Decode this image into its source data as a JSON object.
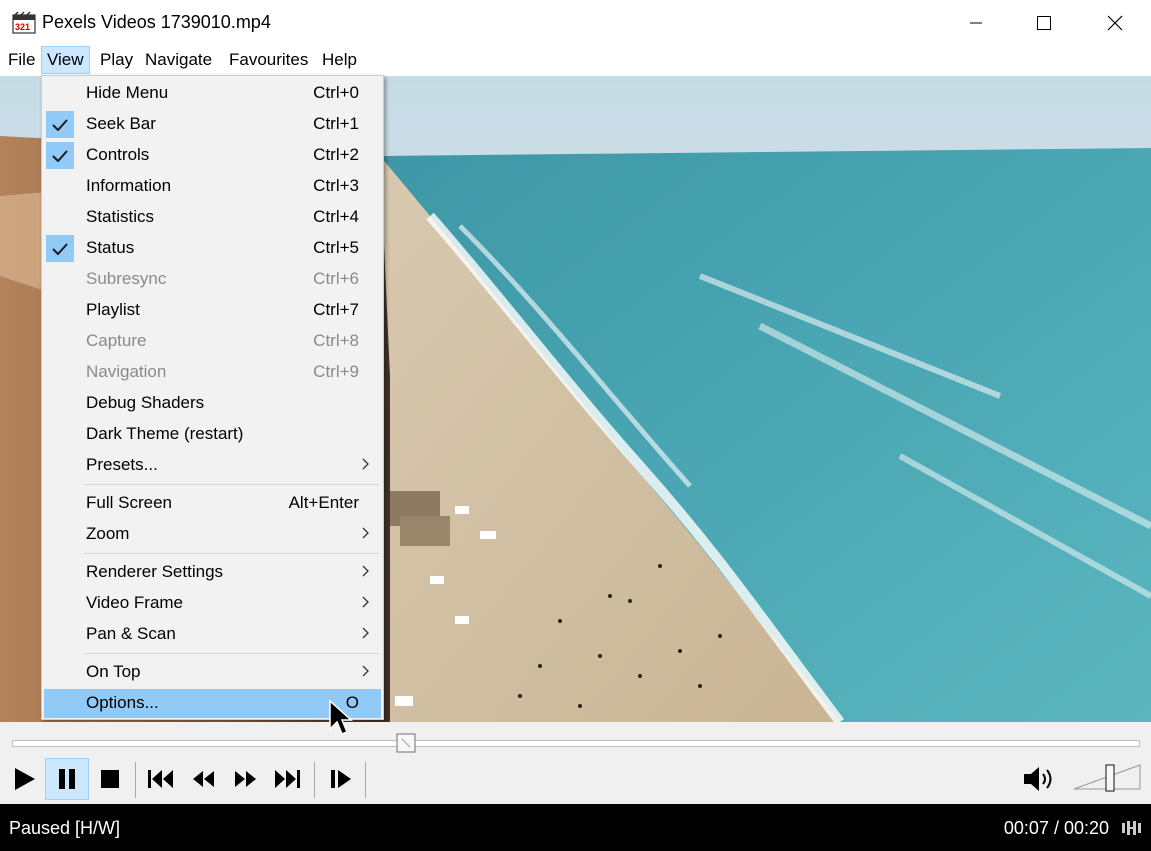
{
  "window": {
    "title": "Pexels Videos 1739010.mp4"
  },
  "menubar": {
    "items": [
      "File",
      "View",
      "Play",
      "Navigate",
      "Favourites",
      "Help"
    ],
    "active": "View"
  },
  "view_menu": {
    "items": [
      {
        "label": "Hide Menu",
        "shortcut": "Ctrl+0",
        "checked": false,
        "disabled": false,
        "submenu": false
      },
      {
        "label": "Seek Bar",
        "shortcut": "Ctrl+1",
        "checked": true,
        "disabled": false,
        "submenu": false
      },
      {
        "label": "Controls",
        "shortcut": "Ctrl+2",
        "checked": true,
        "disabled": false,
        "submenu": false
      },
      {
        "label": "Information",
        "shortcut": "Ctrl+3",
        "checked": false,
        "disabled": false,
        "submenu": false
      },
      {
        "label": "Statistics",
        "shortcut": "Ctrl+4",
        "checked": false,
        "disabled": false,
        "submenu": false
      },
      {
        "label": "Status",
        "shortcut": "Ctrl+5",
        "checked": true,
        "disabled": false,
        "submenu": false
      },
      {
        "label": "Subresync",
        "shortcut": "Ctrl+6",
        "checked": false,
        "disabled": true,
        "submenu": false
      },
      {
        "label": "Playlist",
        "shortcut": "Ctrl+7",
        "checked": false,
        "disabled": false,
        "submenu": false
      },
      {
        "label": "Capture",
        "shortcut": "Ctrl+8",
        "checked": false,
        "disabled": true,
        "submenu": false
      },
      {
        "label": "Navigation",
        "shortcut": "Ctrl+9",
        "checked": false,
        "disabled": true,
        "submenu": false
      },
      {
        "label": "Debug Shaders",
        "shortcut": "",
        "checked": false,
        "disabled": false,
        "submenu": false
      },
      {
        "label": "Dark Theme (restart)",
        "shortcut": "",
        "checked": false,
        "disabled": false,
        "submenu": false
      },
      {
        "label": "Presets...",
        "shortcut": "",
        "checked": false,
        "disabled": false,
        "submenu": true
      },
      {
        "label": "Full Screen",
        "shortcut": "Alt+Enter",
        "checked": false,
        "disabled": false,
        "submenu": false
      },
      {
        "label": "Zoom",
        "shortcut": "",
        "checked": false,
        "disabled": false,
        "submenu": true
      },
      {
        "label": "Renderer Settings",
        "shortcut": "",
        "checked": false,
        "disabled": false,
        "submenu": true
      },
      {
        "label": "Video Frame",
        "shortcut": "",
        "checked": false,
        "disabled": false,
        "submenu": true
      },
      {
        "label": "Pan & Scan",
        "shortcut": "",
        "checked": false,
        "disabled": false,
        "submenu": true
      },
      {
        "label": "On Top",
        "shortcut": "",
        "checked": false,
        "disabled": false,
        "submenu": true
      },
      {
        "label": "Options...",
        "shortcut": "O",
        "checked": false,
        "disabled": false,
        "submenu": false,
        "highlighted": true
      }
    ]
  },
  "seekbar": {
    "position_fraction": 0.35
  },
  "controls": {
    "buttons": [
      "play-icon",
      "pause-icon",
      "stop-icon",
      "previous-icon",
      "rewind-icon",
      "fast-forward-icon",
      "next-icon",
      "frame-step-icon"
    ],
    "active": "pause-icon",
    "volume_icon": "speaker-icon",
    "volume_fraction": 0.7
  },
  "status": {
    "text": "Paused [H/W]",
    "time": "00:07 / 00:20"
  },
  "colors": {
    "highlight": "#91c9f7",
    "menu_active": "#cce8ff",
    "status_bg": "#000000"
  }
}
